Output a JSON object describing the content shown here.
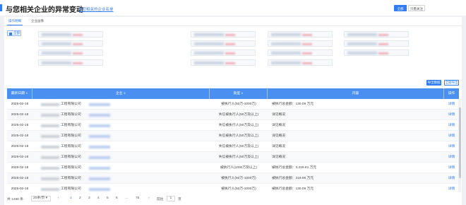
{
  "header": {
    "title": "与您相关企业的异常变动",
    "sublink": "与您相关的企业名单",
    "toggle_all": "全部",
    "toggle_followed": "只看关注"
  },
  "tabs": [
    {
      "label": "操作明细"
    },
    {
      "label": "企业画像"
    }
  ],
  "filters": {
    "all_label": "全部"
  },
  "actions": {
    "btn_primary": "导出数据",
    "btn_secondary": "全部导出"
  },
  "table": {
    "columns": [
      "最新日期",
      "企业",
      "类型",
      "内容",
      "操作"
    ],
    "rows": [
      {
        "date": "2025-02-18",
        "company": "工程有限公司",
        "type": "被执行人(50万-1000万)",
        "content": "被执行总金额：130.09 万元",
        "op": "详情"
      },
      {
        "date": "2025-02-18",
        "company": "工程有限公司",
        "type": "失信被执行人(50万及以上)",
        "content": "详见概况",
        "op": "详情"
      },
      {
        "date": "2025-02-18",
        "company": "工程有限公司",
        "type": "失信被执行人(50万及以上)",
        "content": "详见概况",
        "op": "详情"
      },
      {
        "date": "2025-02-18",
        "company": "工程有限公司",
        "type": "失信被执行人(50万及以上)",
        "content": "详见概况",
        "op": "详情"
      },
      {
        "date": "2025-02-18",
        "company": "工程有限公司",
        "type": "失信被执行人(50万及以上)",
        "content": "详见概况",
        "op": "详情"
      },
      {
        "date": "2025-02-18",
        "company": "工程有限公司",
        "type": "失信被执行人(50万及以上)",
        "content": "详见概况",
        "op": "详情"
      },
      {
        "date": "2025-02-18",
        "company": "工程有限公司",
        "type": "被执行人(1000万及以上)",
        "content": "被执行总金额：3,229.81 万元",
        "op": "详情"
      },
      {
        "date": "2025-02-18",
        "company": "工程有限公司",
        "type": "被执行人(50万-1000万)",
        "content": "被执行总金额：219.96 万元",
        "op": "详情"
      },
      {
        "date": "2025-02-18",
        "company": "工程有限公司",
        "type": "被执行人(50万-1000万)",
        "content": "被执行总金额：130.09 万元",
        "op": "详情"
      }
    ]
  },
  "pager": {
    "total": "共 1488 条",
    "page_size": "20条/页",
    "prev": "‹",
    "pages": [
      "1",
      "2",
      "3",
      "4",
      "5",
      "6",
      "…",
      "75"
    ],
    "next": "›",
    "goto": "前往",
    "goto_value": "1",
    "unit": "页"
  }
}
